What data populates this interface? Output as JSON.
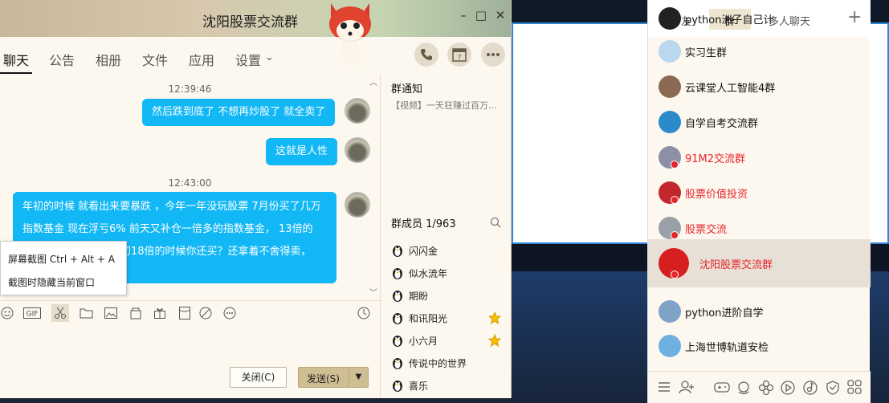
{
  "chat": {
    "title": "沈阳股票交流群",
    "tabs": [
      "聊天",
      "公告",
      "相册",
      "文件",
      "应用",
      "设置"
    ],
    "settings_arrow": "⌄",
    "messages": [
      {
        "time": "12:39:46"
      },
      {
        "text": "然后跌到底了  不想再炒股了 就全卖了"
      },
      {
        "text": "这就是人性"
      },
      {
        "time": "12:43:00"
      },
      {
        "lines": [
          "年初的时候 就看出来要暴跌  ，今年一年没玩股票  7月份买了几万",
          "指数基金 现在浮亏6%   前天又补仓一倍多的指数基金，   13倍的",
          "年初18倍的时候你还买？还拿着不舍得卖，"
        ]
      }
    ],
    "screenshot_menu": [
      "屏幕截图 Ctrl + Alt + A",
      "截图时隐藏当前窗口"
    ],
    "close_label": "关闭(C)",
    "send_label": "发送(S)",
    "notice_title": "群通知",
    "notice_text": "【视频】一天狂赚过百万...",
    "members_title": "群成员 1/963",
    "members": [
      {
        "name": "闪闪金",
        "star": false
      },
      {
        "name": "似水流年",
        "star": false
      },
      {
        "name": "期盼",
        "star": false
      },
      {
        "name": "和讯阳光",
        "star": true
      },
      {
        "name": "小六月",
        "star": true
      },
      {
        "name": "传说中的世界",
        "star": false
      },
      {
        "name": "喜乐",
        "star": false
      }
    ]
  },
  "contacts": {
    "tabs": [
      "好友",
      "群",
      "多人聊天"
    ],
    "plus": "+",
    "groups": [
      {
        "name": "python洲子自己计",
        "red": false
      },
      {
        "name": "实习生群",
        "red": false
      },
      {
        "name": "云课堂人工智能4群",
        "red": false
      },
      {
        "name": "自学自考交流群",
        "red": false
      },
      {
        "name": "91M2交流群",
        "red": true
      },
      {
        "name": "股票价值投资",
        "red": true
      },
      {
        "name": "股票交流",
        "red": true
      },
      {
        "name": "沈阳股票交流群",
        "red": true
      },
      {
        "name": "python进阶自学",
        "red": false
      },
      {
        "name": "上海世博轨道安检",
        "red": false
      }
    ]
  },
  "colors": {
    "bubble": "#12b7f5",
    "accent_red": "#e5262b",
    "send_button": "#cfbd94"
  }
}
